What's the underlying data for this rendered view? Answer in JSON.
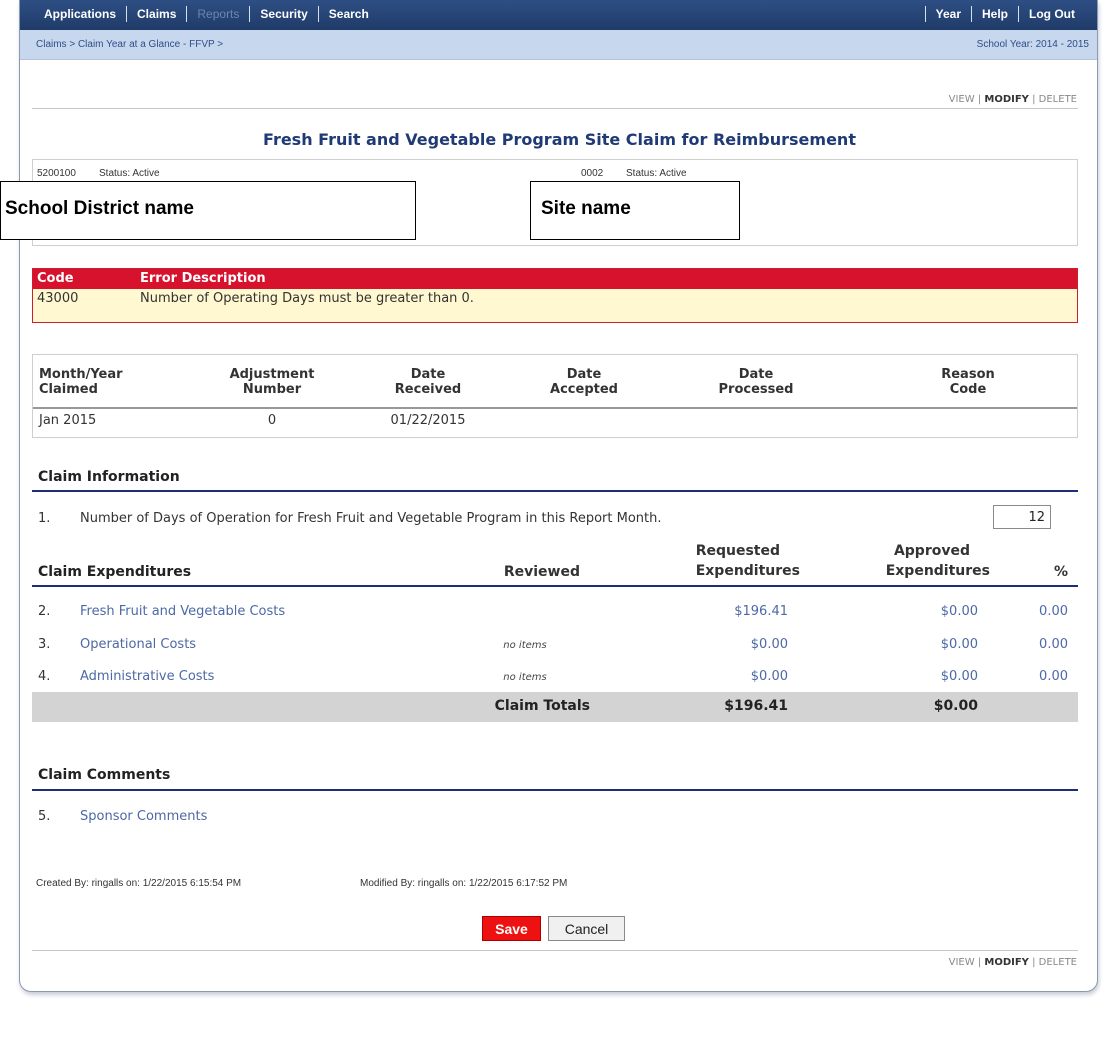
{
  "nav": {
    "left": [
      {
        "label": "Applications",
        "enabled": true
      },
      {
        "label": "Claims",
        "enabled": true
      },
      {
        "label": "Reports",
        "enabled": false
      },
      {
        "label": "Security",
        "enabled": true
      },
      {
        "label": "Search",
        "enabled": true
      }
    ],
    "right": [
      {
        "label": "Year"
      },
      {
        "label": "Help"
      },
      {
        "label": "Log Out"
      }
    ]
  },
  "breadcrumb": "Claims > Claim Year at a Glance - FFVP >",
  "school_year": "School Year: 2014 - 2015",
  "actions": {
    "view": "VIEW",
    "sep": " | ",
    "modify": "MODIFY",
    "delete": "DELETE"
  },
  "page_title": "Fresh Fruit and Vegetable Program Site Claim for Reimbursement",
  "sponsor": {
    "id": "5200100",
    "status": "Status: Active"
  },
  "site": {
    "id": "0002",
    "status": "Status: Active"
  },
  "annotations": {
    "district": "School District name",
    "site": "Site name"
  },
  "errors": {
    "headers": {
      "code": "Code",
      "desc": "Error Description"
    },
    "rows": [
      {
        "code": "43000",
        "desc": "Number of Operating Days must be greater than 0."
      }
    ]
  },
  "month_table": {
    "headers": {
      "month": [
        "Month/Year",
        "Claimed"
      ],
      "adjust": [
        "Adjustment",
        "Number"
      ],
      "received": [
        "Date",
        "Received"
      ],
      "accepted": [
        "Date",
        "Accepted"
      ],
      "processed": [
        "Date",
        "Processed"
      ],
      "reason": [
        "Reason",
        "Code"
      ]
    },
    "row": {
      "month": "Jan 2015",
      "adjust": "0",
      "received": "01/22/2015",
      "accepted": "",
      "processed": "",
      "reason": ""
    }
  },
  "claim_info": {
    "title": "Claim Information",
    "line1": {
      "num": "1.",
      "text": "Number of Days of Operation for Fresh Fruit and Vegetable Program in this Report Month.",
      "value": "12"
    }
  },
  "expenditures": {
    "title": "Claim Expenditures",
    "headers": {
      "reviewed": "Reviewed",
      "requested": [
        "Requested",
        "Expenditures"
      ],
      "approved": [
        "Approved",
        "Expenditures"
      ],
      "pct": "%"
    },
    "rows": [
      {
        "num": "2.",
        "label": "Fresh Fruit and Vegetable Costs",
        "reviewed": "",
        "requested": "$196.41",
        "approved": "$0.00",
        "pct": "0.00"
      },
      {
        "num": "3.",
        "label": "Operational Costs",
        "reviewed": "no items",
        "requested": "$0.00",
        "approved": "$0.00",
        "pct": "0.00"
      },
      {
        "num": "4.",
        "label": "Administrative Costs",
        "reviewed": "no items",
        "requested": "$0.00",
        "approved": "$0.00",
        "pct": "0.00"
      }
    ],
    "totals": {
      "label": "Claim Totals",
      "requested": "$196.41",
      "approved": "$0.00"
    }
  },
  "comments": {
    "title": "Claim Comments",
    "line": {
      "num": "5.",
      "label": "Sponsor Comments"
    }
  },
  "audit": {
    "created": "Created By: ringalls on: 1/22/2015 6:15:54 PM",
    "modified": "Modified By: ringalls on: 1/22/2015 6:17:52 PM"
  },
  "buttons": {
    "save": "Save",
    "cancel": "Cancel"
  }
}
